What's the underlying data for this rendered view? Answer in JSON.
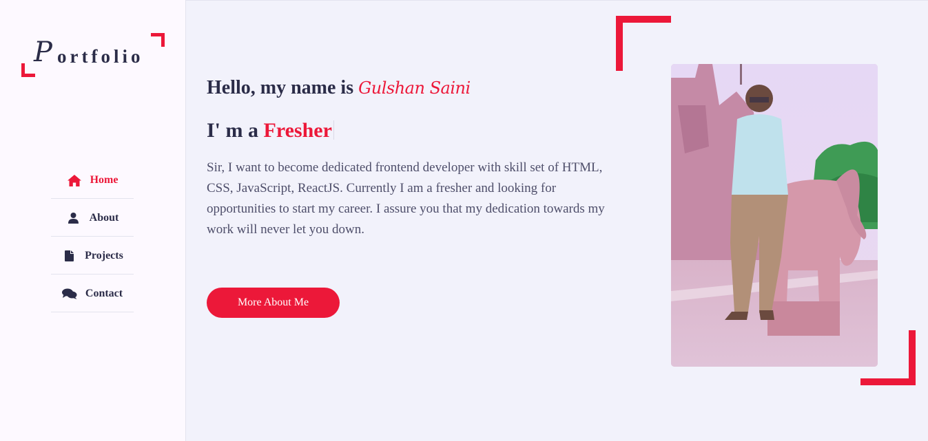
{
  "logo": {
    "first_letter": "P",
    "rest": "ortfolio"
  },
  "nav": [
    {
      "label": "Home",
      "icon": "home-icon",
      "active": true
    },
    {
      "label": "About",
      "icon": "user-icon",
      "active": false
    },
    {
      "label": "Projects",
      "icon": "file-icon",
      "active": false
    },
    {
      "label": "Contact",
      "icon": "comments-icon",
      "active": false
    }
  ],
  "hero": {
    "greeting": "Hello, my name is",
    "name": "Gulshan Saini",
    "role_prefix": "I' m a",
    "role": "Fresher",
    "description": "Sir, I want to become dedicated frontend developer with skill set of HTML, CSS, JavaScript, ReactJS. Currently I am a fresher and looking for opportunities to start my career. I assure you that my dedication towards my work will never let you down.",
    "button_label": "More About Me"
  },
  "colors": {
    "accent": "#ec1839",
    "text_dark": "#2b2c48",
    "background": "#f2f2fb",
    "sidebar_bg": "#fdf9ff"
  }
}
